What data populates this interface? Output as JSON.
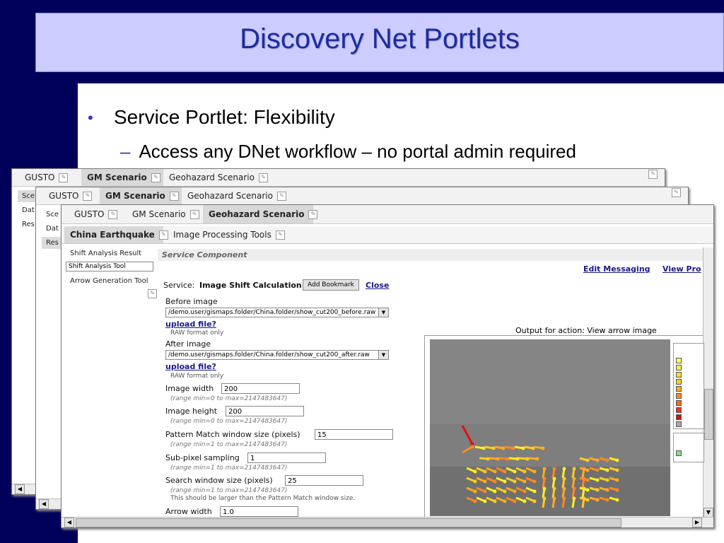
{
  "slide": {
    "title": "Discovery Net Portlets",
    "bullet_1": "Service Portlet: Flexibility",
    "bullet_2": "Access any DNet workflow – no portal admin required",
    "bullet_marker": "•",
    "dash_marker": "–"
  },
  "colors": {
    "slide_navy": "#00005a",
    "title_bg": "#ccccff",
    "title_text": "#1e2c9c",
    "link": "#1a1a88"
  },
  "window_back": {
    "tabs": [
      {
        "label": "GUSTO"
      },
      {
        "label": "GM Scenario"
      },
      {
        "label": "Geohazard Scenario"
      }
    ],
    "side": [
      "Sce",
      "Dat",
      "Res"
    ]
  },
  "window_mid": {
    "tabs": [
      {
        "label": "GUSTO"
      },
      {
        "label": "GM Scenario"
      },
      {
        "label": "Geohazard Scenario"
      }
    ],
    "side": [
      "Sce",
      "Dat",
      "Res"
    ]
  },
  "window_front": {
    "tabs": [
      {
        "label": "GUSTO"
      },
      {
        "label": "GM Scenario"
      },
      {
        "label": "Geohazard Scenario"
      }
    ],
    "subtabs": [
      {
        "label": "China Earthquake"
      },
      {
        "label": "Image Processing Tools"
      }
    ],
    "side": [
      "Shift Analysis Result",
      "Shift Analysis Tool",
      "Arrow Generation Tool"
    ],
    "section_title": "Service Component",
    "edit_messaging": "Edit Messaging",
    "view_pro": "View Pro",
    "service_label": "Service:",
    "service_name": "Image Shift Calculation",
    "add_bookmark": "Add Bookmark",
    "close": "Close",
    "before_image": {
      "label": "Before image",
      "value": "/demo.user/gismaps.folder/China.folder/show_cut200_before.raw",
      "upload": "upload file?",
      "note": "RAW format only"
    },
    "after_image": {
      "label": "After image",
      "value": "/demo.user/gismaps.folder/China.folder/show_cut200_after.raw",
      "upload": "upload file?",
      "note": "RAW format only"
    },
    "fields": [
      {
        "label": "Image width",
        "value": "200",
        "hint": "(range min=0 to max=2147483647)"
      },
      {
        "label": "Image height",
        "value": "200",
        "hint": "(range min=0 to max=2147483647)"
      },
      {
        "label": "Pattern Match window size (pixels)",
        "value": "15",
        "hint": "(range min=1 to max=2147483647)"
      },
      {
        "label": "Sub-pixel sampling",
        "value": "1",
        "hint": "(range min=1 to max=2147483647)"
      },
      {
        "label": "Search window size (pixels)",
        "value": "25",
        "hint": "(range min=1 to max=2147483647)"
      },
      {
        "label": "Arrow width",
        "value": "1.0",
        "hint": ""
      }
    ],
    "search_note": "This should be larger than the Pattern Match window size.",
    "output_caption": "Output for action: View arrow image"
  }
}
